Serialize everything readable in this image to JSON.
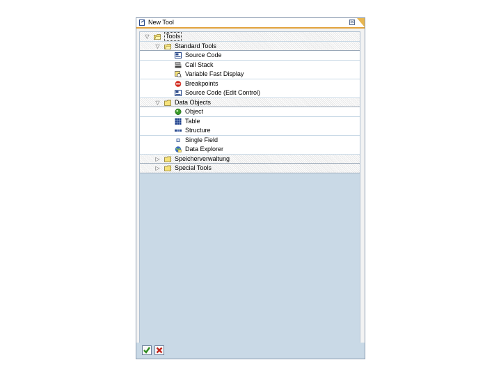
{
  "window": {
    "title": "New Tool",
    "close_glyph": "⊠"
  },
  "tree": [
    {
      "label": "Tools",
      "level": 0,
      "state": "expanded",
      "icon": "folder-open-icon"
    },
    {
      "label": "Standard Tools",
      "level": 1,
      "state": "expanded",
      "icon": "folder-open-icon"
    },
    {
      "label": "Source Code",
      "level": 2,
      "state": "leaf",
      "icon": "source-code-icon"
    },
    {
      "label": "Call Stack",
      "level": 2,
      "state": "leaf",
      "icon": "call-stack-icon"
    },
    {
      "label": "Variable Fast Display",
      "level": 2,
      "state": "leaf",
      "icon": "variable-display-icon"
    },
    {
      "label": "Breakpoints",
      "level": 2,
      "state": "leaf",
      "icon": "stop-sign-icon"
    },
    {
      "label": "Source Code (Edit Control)",
      "level": 2,
      "state": "leaf",
      "icon": "source-code-icon"
    },
    {
      "label": "Data Objects",
      "level": 1,
      "state": "expanded",
      "icon": "folder-icon"
    },
    {
      "label": "Object",
      "level": 2,
      "state": "leaf",
      "icon": "object-icon"
    },
    {
      "label": "Table",
      "level": 2,
      "state": "leaf",
      "icon": "table-icon"
    },
    {
      "label": "Structure",
      "level": 2,
      "state": "leaf",
      "icon": "structure-icon"
    },
    {
      "label": "Single Field",
      "level": 2,
      "state": "leaf",
      "icon": "single-field-icon"
    },
    {
      "label": "Data Explorer",
      "level": 2,
      "state": "leaf",
      "icon": "data-explorer-icon"
    },
    {
      "label": "Speicherverwaltung",
      "level": 1,
      "state": "collapsed",
      "icon": "folder-icon"
    },
    {
      "label": "Special Tools",
      "level": 1,
      "state": "collapsed",
      "icon": "folder-icon"
    }
  ],
  "footer": {
    "buttons": [
      {
        "name": "confirm-button",
        "icon": "checkmark-icon",
        "color": "#2e8b1f"
      },
      {
        "name": "cancel-button",
        "icon": "cross-icon",
        "color": "#c0241b"
      }
    ]
  },
  "colors": {
    "accent": "#e2a33c",
    "panel": "#c9d9e6",
    "folder": "#f6e27a"
  }
}
